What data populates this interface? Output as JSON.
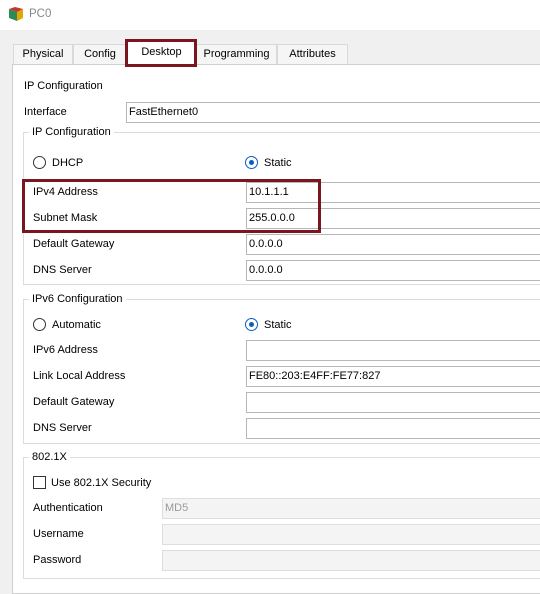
{
  "window": {
    "title": "PC0"
  },
  "tabs": [
    {
      "label": "Physical"
    },
    {
      "label": "Config"
    },
    {
      "label": "Desktop"
    },
    {
      "label": "Programming"
    },
    {
      "label": "Attributes"
    }
  ],
  "panel": {
    "heading": "IP Configuration",
    "interface_label": "Interface",
    "interface_value": "FastEthernet0"
  },
  "ipv4": {
    "group_title": "IP Configuration",
    "dhcp_label": "DHCP",
    "static_label": "Static",
    "mode": "Static",
    "ipv4_address_label": "IPv4 Address",
    "ipv4_address": "10.1.1.1",
    "subnet_mask_label": "Subnet Mask",
    "subnet_mask": "255.0.0.0",
    "gateway_label": "Default Gateway",
    "gateway": "0.0.0.0",
    "dns_label": "DNS Server",
    "dns": "0.0.0.0"
  },
  "ipv6": {
    "group_title": "IPv6 Configuration",
    "automatic_label": "Automatic",
    "static_label": "Static",
    "mode": "Static",
    "ipv6_address_label": "IPv6 Address",
    "ipv6_address": "",
    "link_local_label": "Link Local Address",
    "link_local": "FE80::203:E4FF:FE77:827",
    "gateway_label": "Default Gateway",
    "gateway": "",
    "dns_label": "DNS Server",
    "dns": ""
  },
  "dot1x": {
    "group_title": "802.1X",
    "use_security_label": "Use 802.1X Security",
    "use_security_checked": false,
    "authentication_label": "Authentication",
    "authentication_value": "MD5",
    "username_label": "Username",
    "username": "",
    "password_label": "Password",
    "password": ""
  },
  "colors": {
    "highlight": "#7a1620",
    "radio_selected": "#0a5cc2"
  }
}
